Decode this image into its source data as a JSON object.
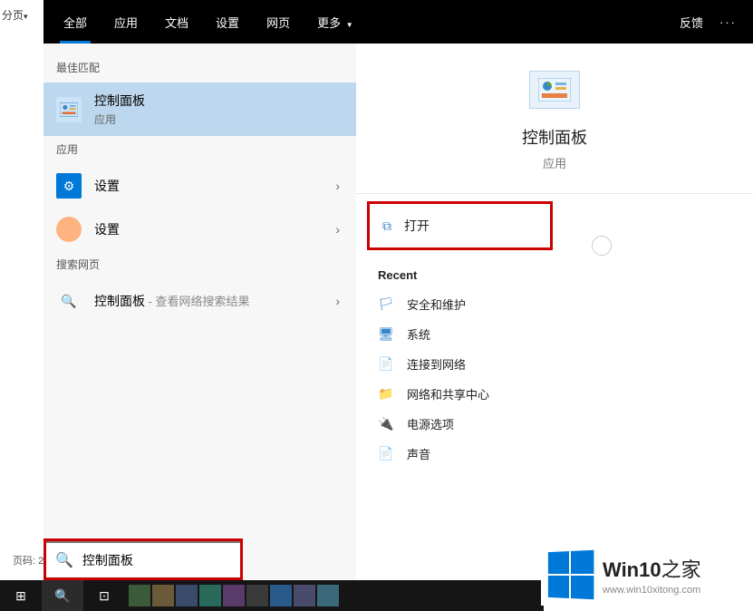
{
  "leftLabel": "分页",
  "tabs": {
    "all": "全部",
    "app": "应用",
    "doc": "文档",
    "settings": "设置",
    "web": "网页",
    "more": "更多"
  },
  "topRight": {
    "feedback": "反馈"
  },
  "sections": {
    "bestMatch": "最佳匹配",
    "apps": "应用",
    "searchWeb": "搜索网页"
  },
  "bestMatch": {
    "title": "控制面板",
    "sub": "应用"
  },
  "appItems": [
    {
      "title": "设置"
    },
    {
      "title": "设置"
    }
  ],
  "webItem": {
    "title": "控制面板",
    "suffix": " - 查看网络搜索结果"
  },
  "preview": {
    "title": "控制面板",
    "sub": "应用"
  },
  "openAction": "打开",
  "recentHeader": "Recent",
  "recent": [
    {
      "icon": "🏳",
      "color": "#3a87c8",
      "text": "安全和维护"
    },
    {
      "icon": "🖥",
      "color": "#3a87c8",
      "text": "系统"
    },
    {
      "icon": "📄",
      "color": "#888",
      "text": "连接到网络"
    },
    {
      "icon": "📁",
      "color": "#e0c030",
      "text": "网络和共享中心"
    },
    {
      "icon": "🔌",
      "color": "#4a8a3a",
      "text": "电源选项"
    },
    {
      "icon": "📄",
      "color": "#888",
      "text": "声音"
    }
  ],
  "searchBox": "控制面板",
  "pageNum": "页码: 2",
  "logo": {
    "main1": "Win10",
    "main2": "之家",
    "url": "www.win10xitong.com"
  },
  "taskbarColors": [
    "#3a5a3a",
    "#6a5a3a",
    "#3a4a6a",
    "#2a6a5a",
    "#5a3a6a",
    "#3a3a3a",
    "#2a5a8a",
    "#4a4a6a",
    "#3a6a7a"
  ]
}
